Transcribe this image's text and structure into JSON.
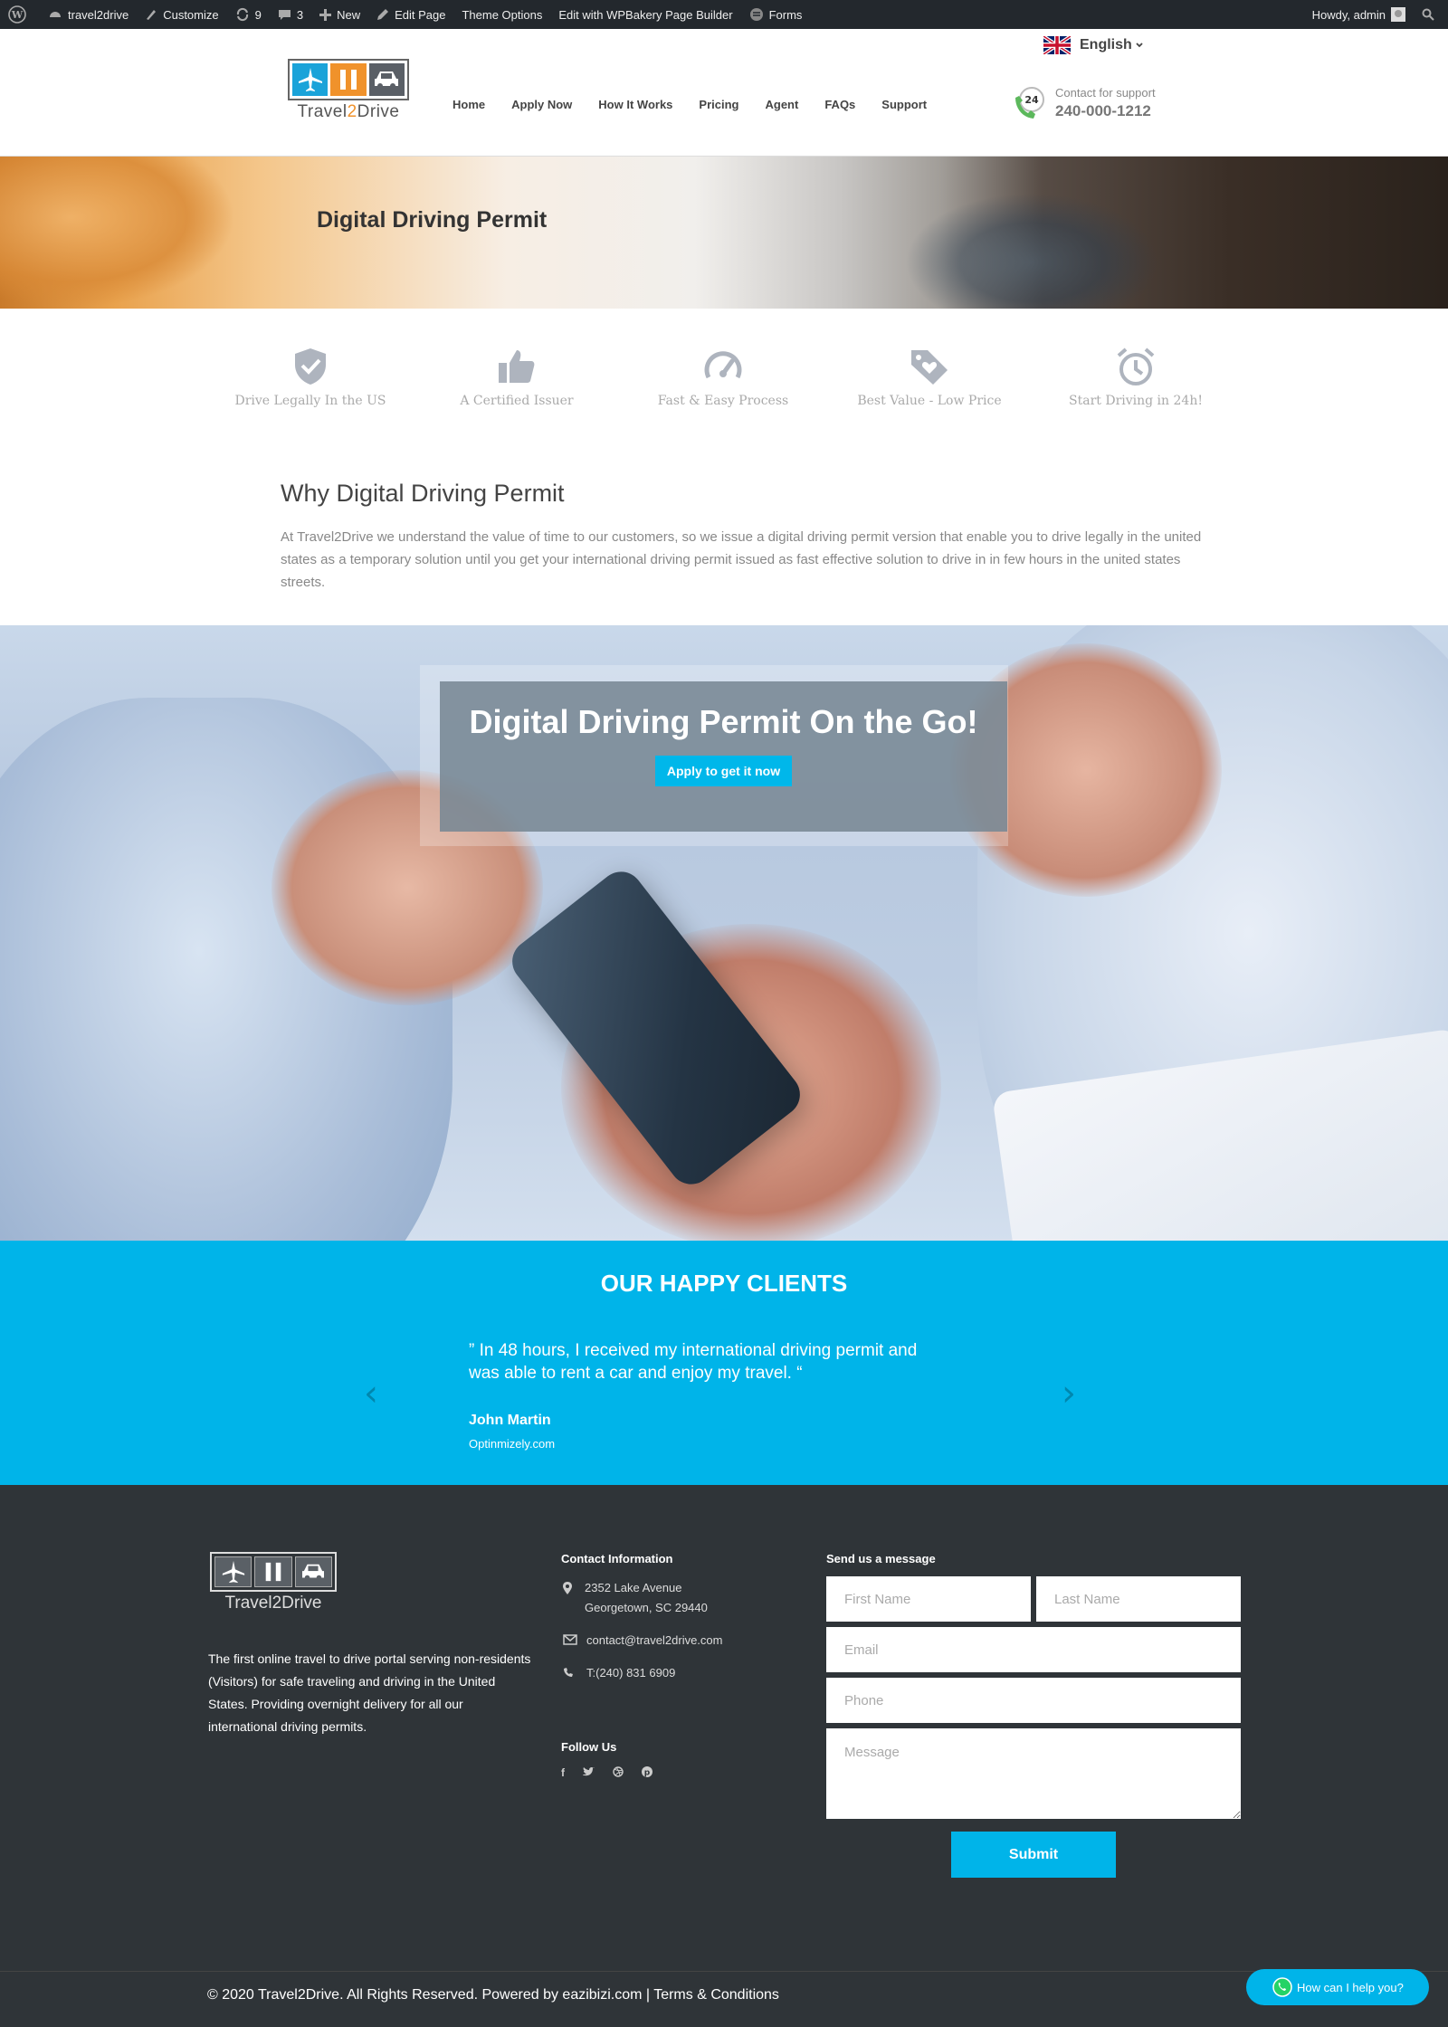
{
  "adminbar": {
    "site": "travel2drive",
    "customize": "Customize",
    "updates": "9",
    "comments": "3",
    "new": "New",
    "edit_page": "Edit Page",
    "theme_options": "Theme Options",
    "wpbakery": "Edit with WPBakery Page Builder",
    "forms": "Forms",
    "howdy": "Howdy, admin"
  },
  "header": {
    "logo_text_1": "Travel",
    "logo_text_2": "2",
    "logo_text_3": "Drive",
    "nav": [
      "Home",
      "Apply Now",
      "How It Works",
      "Pricing",
      "Agent",
      "FAQs",
      "Support"
    ],
    "language": "English",
    "support_badge": "24",
    "support_label": "Contact for support",
    "support_phone": "240-000-1212"
  },
  "hero": {
    "title": "Digital Driving Permit"
  },
  "features": [
    {
      "label": "Drive Legally In the US",
      "icon": "shield-check-icon"
    },
    {
      "label": "A Certified Issuer",
      "icon": "thumbs-up-icon"
    },
    {
      "label": "Fast & Easy Process",
      "icon": "speedometer-icon"
    },
    {
      "label": "Best Value - Low Price",
      "icon": "price-tag-heart-icon"
    },
    {
      "label": "Start Driving in 24h!",
      "icon": "alarm-clock-icon"
    }
  ],
  "why": {
    "title": "Why Digital Driving Permit",
    "body": "At Travel2Drive we understand the value of time to our customers, so we issue a digital driving permit version that enable you to drive legally in the united states as a temporary solution until you get your international driving permit issued as fast effective solution to drive in in few hours in the united states streets."
  },
  "cta": {
    "title": "Digital Driving Permit On the Go!",
    "button": "Apply to get it now"
  },
  "clients": {
    "title": "OUR HAPPY CLIENTS",
    "quote": "” In 48 hours, I received my international driving permit and was able to rent a car and enjoy my travel. “",
    "name": "John Martin",
    "site": "Optinmizely.com",
    "prev": "‹",
    "next": "›"
  },
  "footer": {
    "logo_text": "Travel2Drive",
    "about": "The first online travel to drive portal serving non-residents (Visitors) for safe traveling and driving in the United States. Providing overnight delivery for all our international driving permits.",
    "contact_title": "Contact Information",
    "address_line1": "2352 Lake Avenue",
    "address_line2": "Georgetown, SC 29440",
    "email": "contact@travel2drive.com",
    "phone": "T:(240) 831 6909",
    "follow_title": "Follow Us",
    "social": [
      "f",
      "t",
      "d",
      "p"
    ],
    "form_title": "Send us a message",
    "placeholders": {
      "first_name": "First Name",
      "last_name": "Last Name",
      "email": "Email",
      "phone": "Phone",
      "message": "Message"
    },
    "submit": "Submit",
    "copyright": "© 2020 Travel2Drive. All Rights Reserved. Powered by eazibizi.com | Terms & Conditions"
  },
  "whatsapp": {
    "label": "How can I help you?"
  },
  "colors": {
    "accent": "#00b4e9",
    "adminbar": "#23282d",
    "footer": "#2f3438",
    "logo_blue": "#1aa3d9",
    "logo_orange": "#f0922b"
  }
}
